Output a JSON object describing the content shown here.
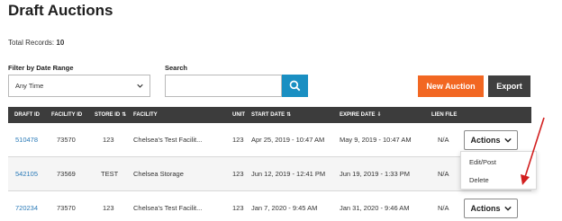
{
  "page": {
    "title": "Draft Auctions",
    "total_records_label": "Total Records:",
    "total_records_value": "10"
  },
  "filters": {
    "date_range_label": "Filter by Date Range",
    "date_range_value": "Any Time",
    "search_label": "Search",
    "search_value": "",
    "search_icon": "search-icon"
  },
  "buttons": {
    "new_auction": "New Auction",
    "export": "Export"
  },
  "colors": {
    "primary": "#f26722",
    "search": "#1a8fc2",
    "dark": "#3f3f3f",
    "link": "#2a7ab8",
    "annotation": "#d21f1f"
  },
  "table": {
    "columns": [
      "DRAFT ID",
      "FACILITY ID",
      "STORE ID",
      "FACILITY",
      "UNIT",
      "START DATE",
      "EXPIRE DATE",
      "LIEN FILE"
    ],
    "rows": [
      {
        "draft_id": "510478",
        "facility_id": "73570",
        "store_id": "123",
        "facility": "Chelsea's Test Facilit...",
        "unit": "123",
        "start_date": "Apr 25, 2019 - 10:47 AM",
        "expire_date": "May 9, 2019 - 10:47 AM",
        "lien_file": "N/A",
        "actions": "Actions"
      },
      {
        "draft_id": "542105",
        "facility_id": "73569",
        "store_id": "TEST",
        "facility": "Chelsea Storage",
        "unit": "123",
        "start_date": "Jun 12, 2019 - 12:41 PM",
        "expire_date": "Jun 19, 2019 - 1:33 PM",
        "lien_file": "N/A",
        "actions": ""
      },
      {
        "draft_id": "720234",
        "facility_id": "73570",
        "store_id": "123",
        "facility": "Chelsea's Test Facilit...",
        "unit": "123",
        "start_date": "Jan 7, 2020 - 9:45 AM",
        "expire_date": "Jan 31, 2020 - 9:46 AM",
        "lien_file": "N/A",
        "actions": "Actions"
      }
    ]
  },
  "actions_menu": {
    "items": [
      "Edit/Post",
      "Delete"
    ]
  }
}
